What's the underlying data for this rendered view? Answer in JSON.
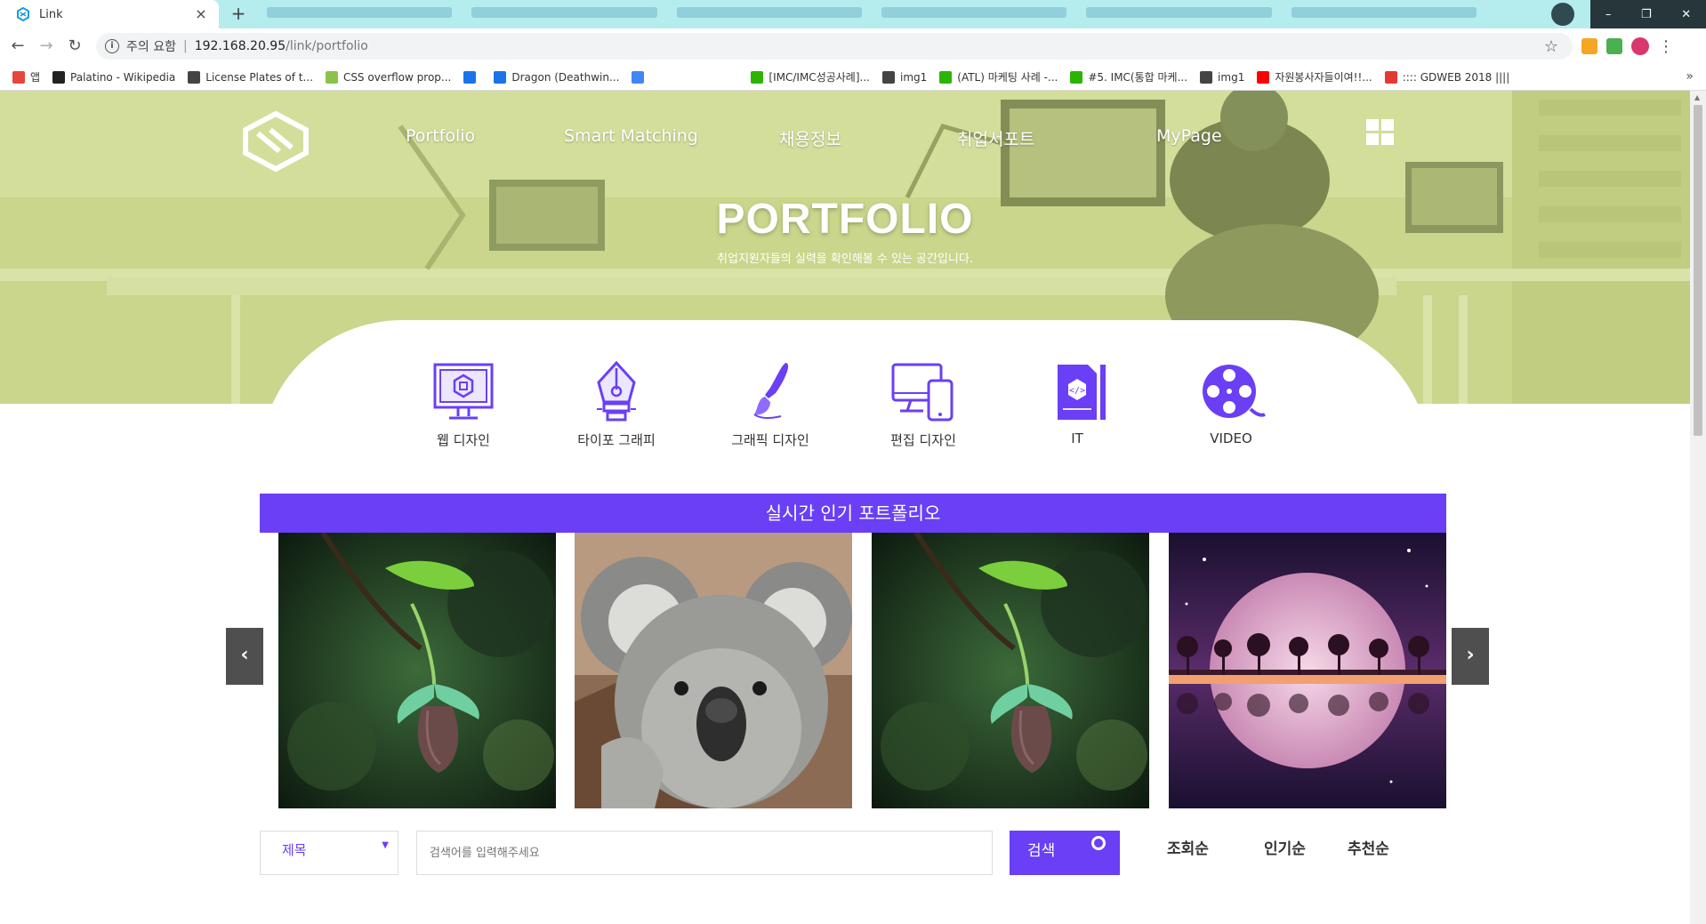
{
  "browser": {
    "tab_title": "Link",
    "tab_close": "×",
    "new_tab": "+",
    "security_label": "주의 요함",
    "url_host": "192.168.20.95",
    "url_path": "/link/portfolio",
    "bookmarks": [
      {
        "label": "앱",
        "icon": "apps-grid-icon",
        "color": "#e8453c"
      },
      {
        "label": "Palatino - Wikipedia",
        "icon": "wikipedia-icon",
        "color": "#222222"
      },
      {
        "label": "License Plates of t...",
        "icon": "globe-icon",
        "color": "#444444"
      },
      {
        "label": "CSS overflow prop...",
        "icon": "css-icon",
        "color": "#8bc34a"
      },
      {
        "label": "",
        "icon": "translate-icon",
        "color": "#1a73e8"
      },
      {
        "label": "Dragon (Deathwin...",
        "icon": "translate-icon",
        "color": "#1a73e8"
      },
      {
        "label": "",
        "icon": "google-icon",
        "color": "#4285f4"
      },
      {
        "label": "[IMC/IMC성공사례]...",
        "icon": "naver-icon",
        "color": "#2db400"
      },
      {
        "label": "img1",
        "icon": "globe-icon",
        "color": "#444444"
      },
      {
        "label": "(ATL) 마케팅 사례 -...",
        "icon": "naver-icon",
        "color": "#2db400"
      },
      {
        "label": "#5. IMC(통합 마케...",
        "icon": "naver-icon",
        "color": "#2db400"
      },
      {
        "label": "img1",
        "icon": "globe-icon",
        "color": "#444444"
      },
      {
        "label": "자원봉사자들이여!!...",
        "icon": "youtube-icon",
        "color": "#ff0000"
      },
      {
        "label": ":::: GDWEB 2018 ||||",
        "icon": "gdweb-icon",
        "color": "#e53935"
      }
    ],
    "bookmarks_more": "»"
  },
  "site": {
    "nav": [
      {
        "label": "Portfolio"
      },
      {
        "label": "Smart Matching"
      },
      {
        "label": "채용정보"
      },
      {
        "label": "취업서포트"
      },
      {
        "label": "MyPage"
      }
    ],
    "hero_title": "PORTFOLIO",
    "hero_subtitle": "취업지원자들의 실력을 확인해볼 수 있는 공간입니다.",
    "categories": [
      {
        "label": "웹 디자인",
        "icon": "monitor-icon"
      },
      {
        "label": "타이포 그래피",
        "icon": "pen-nib-icon"
      },
      {
        "label": "그래픽 디자인",
        "icon": "brush-icon"
      },
      {
        "label": "편집 디자인",
        "icon": "devices-icon"
      },
      {
        "label": "IT",
        "icon": "code-file-icon"
      },
      {
        "label": "VIDEO",
        "icon": "film-reel-icon"
      }
    ],
    "popular_title": "실시간 인기 포트폴리오",
    "slides": [
      {
        "subject": "flower-bud"
      },
      {
        "subject": "koala"
      },
      {
        "subject": "flower-bud"
      },
      {
        "subject": "pink-moon-trees"
      }
    ],
    "carousel_prev": "‹",
    "carousel_next": "›",
    "search": {
      "select_label": "제목",
      "placeholder": "검색어를 입력해주세요",
      "button_label": "검색"
    },
    "sort_links": [
      "조회순",
      "인기순",
      "추천순"
    ]
  },
  "colors": {
    "accent": "#6a3ff5",
    "hero_tint": "#c9d58d",
    "tab_strip": "#b5ecee"
  }
}
